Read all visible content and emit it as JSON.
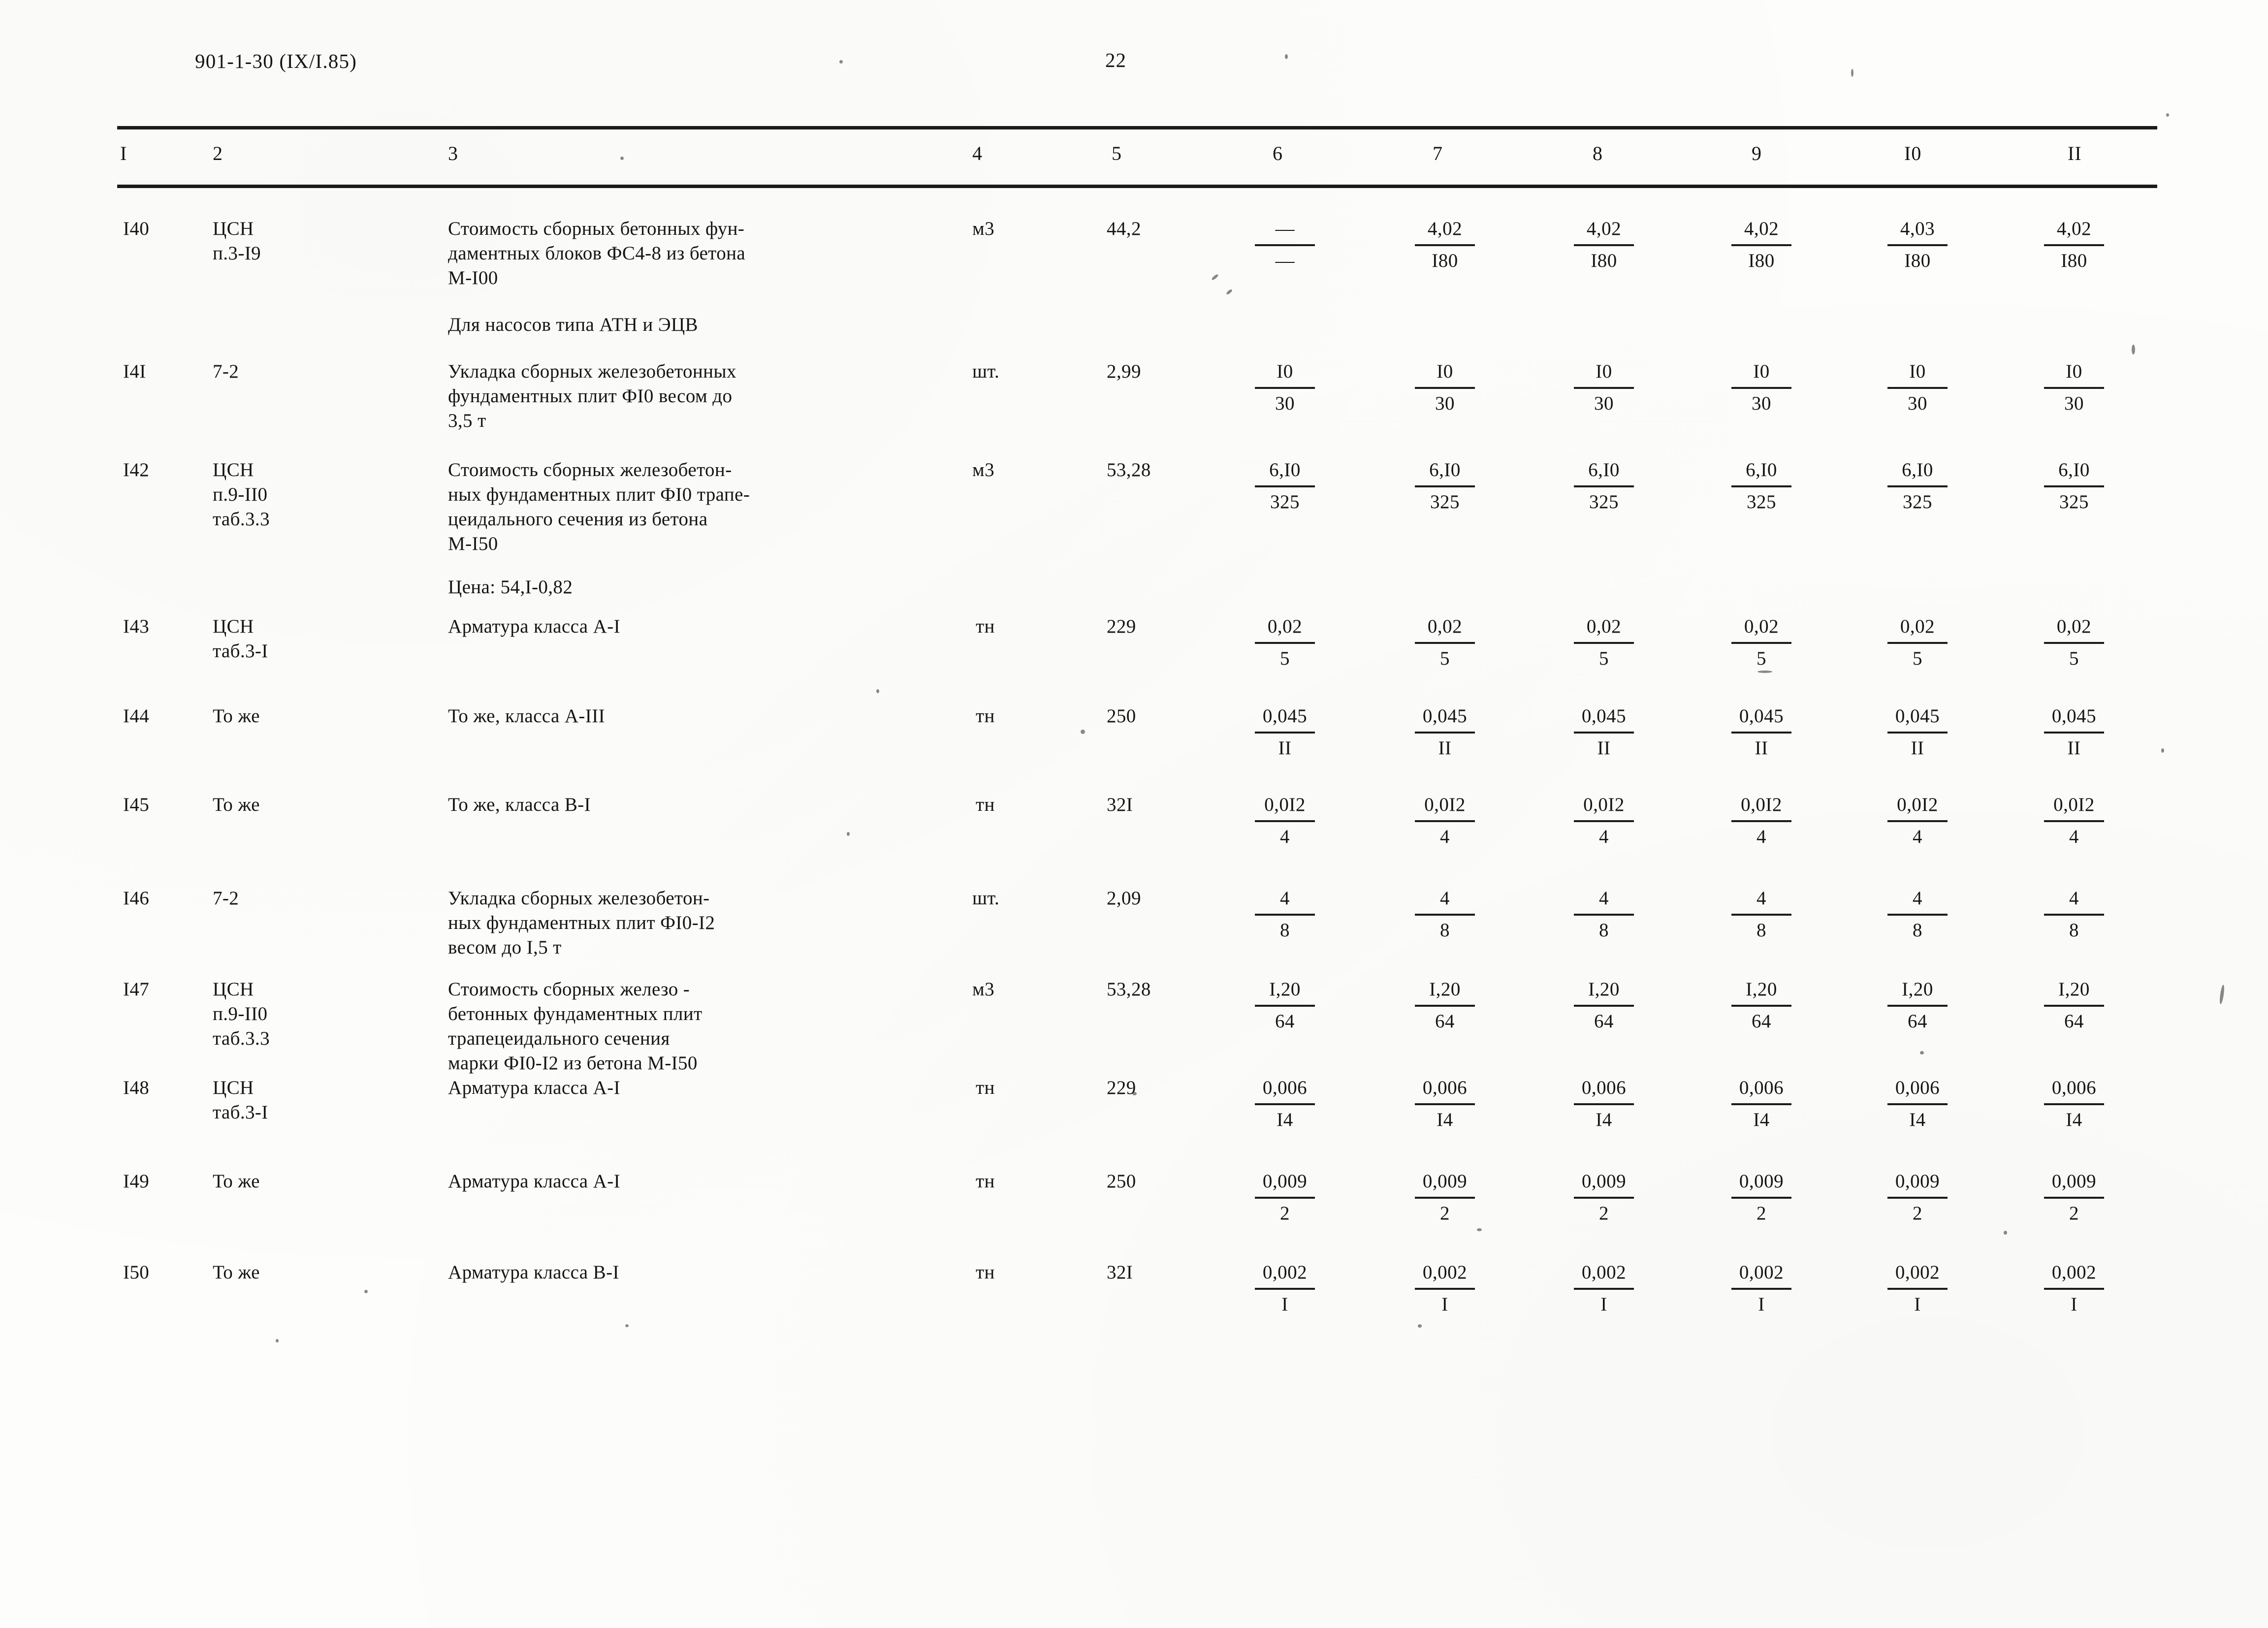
{
  "header": {
    "doc_code": "901-1-30 (IX/I.85)",
    "page_number": "22"
  },
  "table": {
    "column_headers": [
      "I",
      "2",
      "3",
      "4",
      "5",
      "6",
      "7",
      "8",
      "9",
      "I0",
      "II"
    ],
    "rows": [
      {
        "num": "I40",
        "code": "ЦСН\nп.3-I9",
        "desc": "Стоимость сборных бетонных фун-\nдаментных блоков ФС4-8 из бетона\nМ-I00",
        "unit": "м3",
        "qty": "44,2",
        "cols": [
          {
            "top": "—",
            "bot": "—"
          },
          {
            "top": "4,02",
            "bot": "I80"
          },
          {
            "top": "4,02",
            "bot": "I80"
          },
          {
            "top": "4,02",
            "bot": "I80"
          },
          {
            "top": "4,03",
            "bot": "I80"
          },
          {
            "top": "4,02",
            "bot": "I80"
          }
        ]
      },
      {
        "num": "I4I",
        "code": "7-2",
        "desc": "Укладка сборных железобетонных\nфундаментных плит ФI0 весом до\n3,5 т",
        "unit": "шт.",
        "qty": "2,99",
        "cols": [
          {
            "top": "I0",
            "bot": "30"
          },
          {
            "top": "I0",
            "bot": "30"
          },
          {
            "top": "I0",
            "bot": "30"
          },
          {
            "top": "I0",
            "bot": "30"
          },
          {
            "top": "I0",
            "bot": "30"
          },
          {
            "top": "I0",
            "bot": "30"
          }
        ]
      },
      {
        "num": "I42",
        "code": "ЦСН\nп.9-II0\nтаб.3.3",
        "desc": "Стоимость сборных железобетон-\nных фундаментных плит ФI0 трапе-\nцеидального сечения из бетона\nМ-I50",
        "unit": "м3",
        "qty": "53,28",
        "cols": [
          {
            "top": "6,I0",
            "bot": "325"
          },
          {
            "top": "6,I0",
            "bot": "325"
          },
          {
            "top": "6,I0",
            "bot": "325"
          },
          {
            "top": "6,I0",
            "bot": "325"
          },
          {
            "top": "6,I0",
            "bot": "325"
          },
          {
            "top": "6,I0",
            "bot": "325"
          }
        ]
      },
      {
        "num": "I43",
        "code": "ЦСН\nтаб.3-I",
        "desc": "Арматура класса А-I",
        "unit": "тн",
        "qty": "229",
        "cols": [
          {
            "top": "0,02",
            "bot": "5"
          },
          {
            "top": "0,02",
            "bot": "5"
          },
          {
            "top": "0,02",
            "bot": "5"
          },
          {
            "top": "0,02",
            "bot": "5"
          },
          {
            "top": "0,02",
            "bot": "5"
          },
          {
            "top": "0,02",
            "bot": "5"
          }
        ]
      },
      {
        "num": "I44",
        "code": "То же",
        "desc": "То же, класса А-III",
        "unit": "тн",
        "qty": "250",
        "cols": [
          {
            "top": "0,045",
            "bot": "II"
          },
          {
            "top": "0,045",
            "bot": "II"
          },
          {
            "top": "0,045",
            "bot": "II"
          },
          {
            "top": "0,045",
            "bot": "II"
          },
          {
            "top": "0,045",
            "bot": "II"
          },
          {
            "top": "0,045",
            "bot": "II"
          }
        ]
      },
      {
        "num": "I45",
        "code": "То же",
        "desc": "То же, класса В-I",
        "unit": "тн",
        "qty": "32I",
        "cols": [
          {
            "top": "0,0I2",
            "bot": "4"
          },
          {
            "top": "0,0I2",
            "bot": "4"
          },
          {
            "top": "0,0I2",
            "bot": "4"
          },
          {
            "top": "0,0I2",
            "bot": "4"
          },
          {
            "top": "0,0I2",
            "bot": "4"
          },
          {
            "top": "0,0I2",
            "bot": "4"
          }
        ]
      },
      {
        "num": "I46",
        "code": "7-2",
        "desc": "Укладка сборных железобетон-\nных фундаментных плит ФI0-I2\nвесом до I,5 т",
        "unit": "шт.",
        "qty": "2,09",
        "cols": [
          {
            "top": "4",
            "bot": "8"
          },
          {
            "top": "4",
            "bot": "8"
          },
          {
            "top": "4",
            "bot": "8"
          },
          {
            "top": "4",
            "bot": "8"
          },
          {
            "top": "4",
            "bot": "8"
          },
          {
            "top": "4",
            "bot": "8"
          }
        ]
      },
      {
        "num": "I47",
        "code": "ЦСН\nп.9-II0\nтаб.3.3",
        "desc": "Стоимость сборных железо -\nбетонных фундаментных плит\nтрапецеидального сечения\nмарки ФI0-I2 из бетона М-I50",
        "unit": "м3",
        "qty": "53,28",
        "cols": [
          {
            "top": "I,20",
            "bot": "64"
          },
          {
            "top": "I,20",
            "bot": "64"
          },
          {
            "top": "I,20",
            "bot": "64"
          },
          {
            "top": "I,20",
            "bot": "64"
          },
          {
            "top": "I,20",
            "bot": "64"
          },
          {
            "top": "I,20",
            "bot": "64"
          }
        ]
      },
      {
        "num": "I48",
        "code": "ЦСН\nтаб.3-I",
        "desc": "Арматура класса А-I",
        "unit": "тн",
        "qty": "229",
        "cols": [
          {
            "top": "0,006",
            "bot": "I4"
          },
          {
            "top": "0,006",
            "bot": "I4"
          },
          {
            "top": "0,006",
            "bot": "I4"
          },
          {
            "top": "0,006",
            "bot": "I4"
          },
          {
            "top": "0,006",
            "bot": "I4"
          },
          {
            "top": "0,006",
            "bot": "I4"
          }
        ]
      },
      {
        "num": "I49",
        "code": "То же",
        "desc": "Арматура класса А-I",
        "unit": "тн",
        "qty": "250",
        "cols": [
          {
            "top": "0,009",
            "bot": "2"
          },
          {
            "top": "0,009",
            "bot": "2"
          },
          {
            "top": "0,009",
            "bot": "2"
          },
          {
            "top": "0,009",
            "bot": "2"
          },
          {
            "top": "0,009",
            "bot": "2"
          },
          {
            "top": "0,009",
            "bot": "2"
          }
        ]
      },
      {
        "num": "I50",
        "code": "То же",
        "desc": "Арматура класса В-I",
        "unit": "тн",
        "qty": "32I",
        "cols": [
          {
            "top": "0,002",
            "bot": "I"
          },
          {
            "top": "0,002",
            "bot": "I"
          },
          {
            "top": "0,002",
            "bot": "I"
          },
          {
            "top": "0,002",
            "bot": "I"
          },
          {
            "top": "0,002",
            "bot": "I"
          },
          {
            "top": "0,002",
            "bot": "I"
          }
        ]
      }
    ],
    "notes": [
      {
        "text": "Для насосов типа АТН и ЭЦВ"
      },
      {
        "text": "Цена: 54,I-0,82"
      }
    ]
  }
}
